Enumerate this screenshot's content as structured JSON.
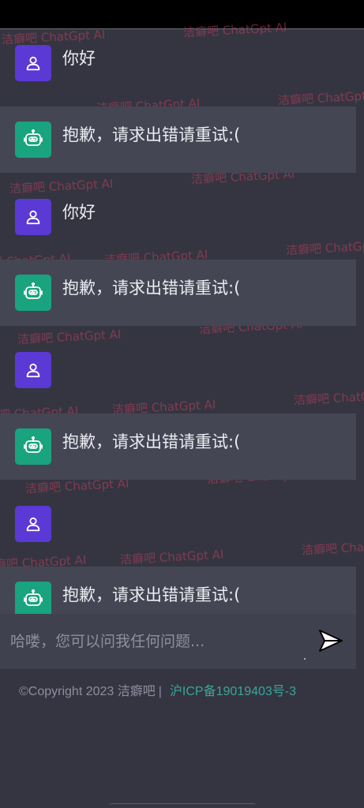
{
  "watermark": "洁癖吧 ChatGpt AI",
  "messages": [
    {
      "role": "user",
      "text": "你好"
    },
    {
      "role": "assistant",
      "text": "抱歉，请求出错请重试:("
    },
    {
      "role": "user",
      "text": "你好"
    },
    {
      "role": "assistant",
      "text": "抱歉，请求出错请重试:("
    },
    {
      "role": "user",
      "text": ""
    },
    {
      "role": "assistant",
      "text": "抱歉，请求出错请重试:("
    },
    {
      "role": "user",
      "text": ""
    },
    {
      "role": "assistant",
      "text": "抱歉，请求出错请重试:("
    }
  ],
  "input": {
    "placeholder": "哈喽，您可以问我任何问题...",
    "value": ""
  },
  "footer": {
    "copyright": "©Copyright 2023 洁癖吧",
    "separator": "|",
    "icp": "沪ICP备19019403号-3"
  },
  "colors": {
    "background": "#343541",
    "assistant_row": "#444654",
    "user_avatar": "#5b39d4",
    "bot_avatar": "#19a37e",
    "watermark": "#c0405f",
    "icp_link": "#3aa59b"
  },
  "icons": {
    "user_avatar": "user-icon",
    "bot_avatar": "robot-icon",
    "send": "send-icon"
  }
}
